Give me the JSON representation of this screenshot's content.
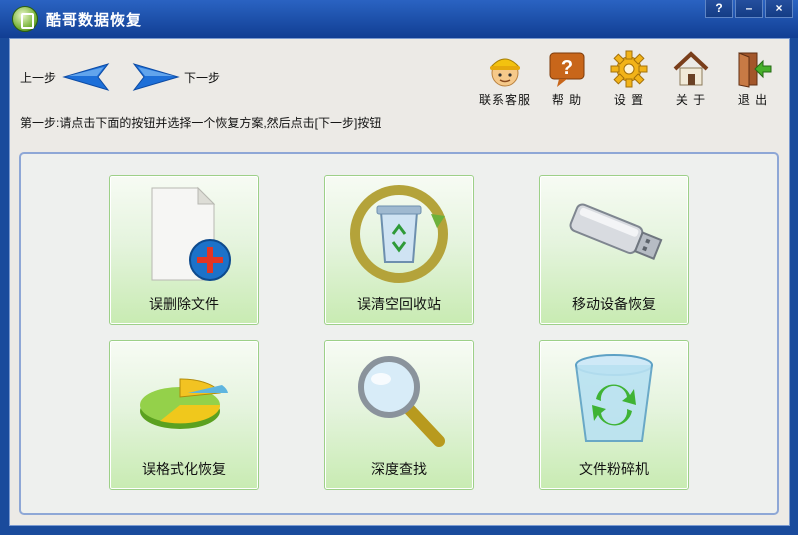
{
  "window": {
    "title": "酷哥数据恢复",
    "controls": {
      "help": "?",
      "minimize": "–",
      "close": "×"
    }
  },
  "nav": {
    "prev_label": "上一步",
    "next_label": "下一步"
  },
  "toolbar": {
    "service": "联系客服",
    "help": "帮 助",
    "settings": "设 置",
    "about": "关 于",
    "exit": "退 出"
  },
  "instruction": "第一步:请点击下面的按钮并选择一个恢复方案,然后点击[下一步]按钮",
  "options": [
    {
      "label": "误删除文件",
      "icon": "document-add-icon"
    },
    {
      "label": "误清空回收站",
      "icon": "recycle-bin-restore-icon"
    },
    {
      "label": "移动设备恢复",
      "icon": "usb-drive-icon"
    },
    {
      "label": "误格式化恢复",
      "icon": "pie-chart-icon"
    },
    {
      "label": "深度查找",
      "icon": "magnifier-icon"
    },
    {
      "label": "文件粉碎机",
      "icon": "shredder-bin-icon"
    }
  ],
  "colors": {
    "titlebar": "#1a4b9c",
    "card_green": "#c8ebb2",
    "accent_blue": "#1d6fd8"
  }
}
